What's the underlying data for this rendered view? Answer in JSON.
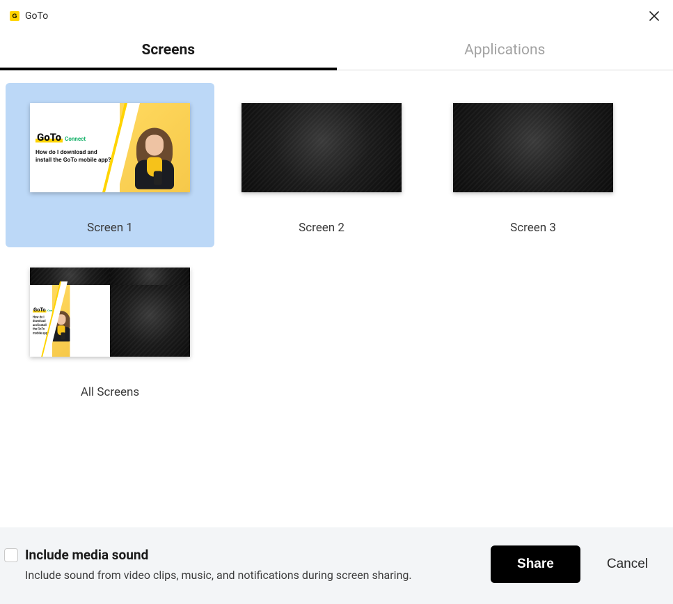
{
  "app": {
    "title": "GoTo"
  },
  "tabs": {
    "screens": "Screens",
    "applications": "Applications",
    "active": "screens"
  },
  "screens": [
    {
      "id": "screen1",
      "label": "Screen 1",
      "selected": true,
      "kind": "goto"
    },
    {
      "id": "screen2",
      "label": "Screen 2",
      "selected": false,
      "kind": "dark"
    },
    {
      "id": "screen3",
      "label": "Screen 3",
      "selected": false,
      "kind": "dark"
    },
    {
      "id": "all",
      "label": "All Screens",
      "selected": false,
      "kind": "composite"
    }
  ],
  "preview": {
    "logo_text": "GoTo",
    "logo_sub": "Connect",
    "question": "How do I download and install the GoTo mobile app?"
  },
  "footer": {
    "media_title": "Include media sound",
    "media_desc": "Include sound from video clips, music, and notifications during screen sharing.",
    "checked": false,
    "share": "Share",
    "cancel": "Cancel"
  }
}
